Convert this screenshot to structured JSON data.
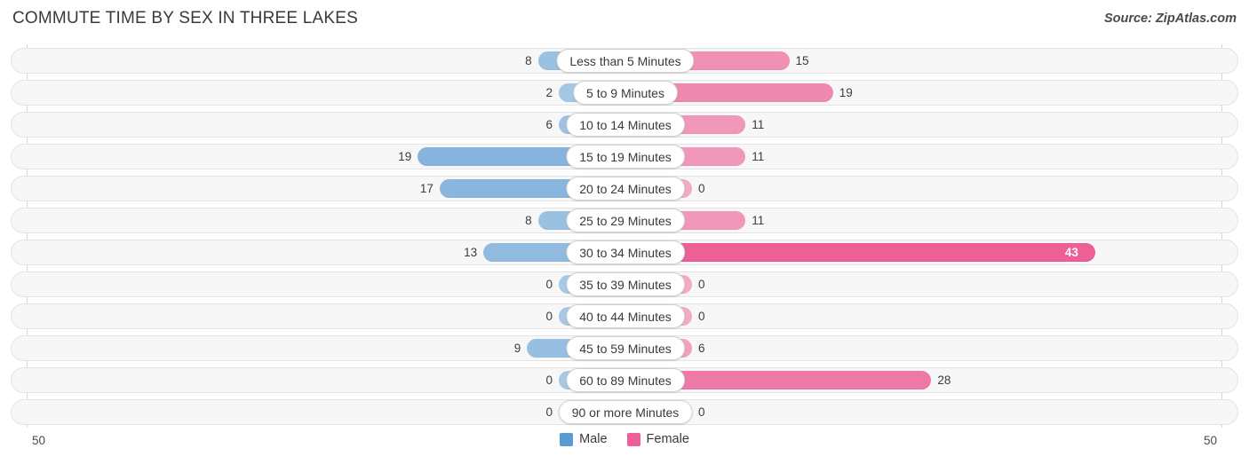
{
  "header": {
    "title": "COMMUTE TIME BY SEX IN THREE LAKES",
    "source": "Source: ZipAtlas.com"
  },
  "axis": {
    "left_max_label": "50",
    "right_max_label": "50"
  },
  "legend": {
    "items": [
      {
        "label": "Male",
        "color": "#5b9bd5"
      },
      {
        "label": "Female",
        "color": "#ee5f96"
      }
    ]
  },
  "chart_data": {
    "type": "bar",
    "subtype": "diverging-bar",
    "title": "COMMUTE TIME BY SEX IN THREE LAKES",
    "xlabel": "",
    "ylabel": "",
    "xlim": [
      -50,
      50
    ],
    "grid": false,
    "legend_position": "bottom-center",
    "axis_max": 50,
    "categories": [
      "Less than 5 Minutes",
      "5 to 9 Minutes",
      "10 to 14 Minutes",
      "15 to 19 Minutes",
      "20 to 24 Minutes",
      "25 to 29 Minutes",
      "30 to 34 Minutes",
      "35 to 39 Minutes",
      "40 to 44 Minutes",
      "45 to 59 Minutes",
      "60 to 89 Minutes",
      "90 or more Minutes"
    ],
    "series": [
      {
        "name": "Male",
        "color": "#5b9bd5",
        "side": "left",
        "values": [
          8,
          2,
          6,
          19,
          17,
          8,
          13,
          0,
          0,
          9,
          0,
          0
        ]
      },
      {
        "name": "Female",
        "color": "#ee5f96",
        "side": "right",
        "values": [
          15,
          19,
          11,
          11,
          0,
          11,
          43,
          0,
          0,
          6,
          28,
          0
        ]
      }
    ],
    "rows": [
      {
        "category": "Less than 5 Minutes",
        "male": 8,
        "female": 15,
        "male_label": "8",
        "female_label": "15"
      },
      {
        "category": "5 to 9 Minutes",
        "male": 2,
        "female": 19,
        "male_label": "2",
        "female_label": "19"
      },
      {
        "category": "10 to 14 Minutes",
        "male": 6,
        "female": 11,
        "male_label": "6",
        "female_label": "11"
      },
      {
        "category": "15 to 19 Minutes",
        "male": 19,
        "female": 11,
        "male_label": "19",
        "female_label": "11"
      },
      {
        "category": "20 to 24 Minutes",
        "male": 17,
        "female": 0,
        "male_label": "17",
        "female_label": "0"
      },
      {
        "category": "25 to 29 Minutes",
        "male": 8,
        "female": 11,
        "male_label": "8",
        "female_label": "11"
      },
      {
        "category": "30 to 34 Minutes",
        "male": 13,
        "female": 43,
        "male_label": "13",
        "female_label": "43"
      },
      {
        "category": "35 to 39 Minutes",
        "male": 0,
        "female": 0,
        "male_label": "0",
        "female_label": "0"
      },
      {
        "category": "40 to 44 Minutes",
        "male": 0,
        "female": 0,
        "male_label": "0",
        "female_label": "0"
      },
      {
        "category": "45 to 59 Minutes",
        "male": 9,
        "female": 6,
        "male_label": "9",
        "female_label": "6"
      },
      {
        "category": "60 to 89 Minutes",
        "male": 0,
        "female": 28,
        "male_label": "0",
        "female_label": "28"
      },
      {
        "category": "90 or more Minutes",
        "male": 0,
        "female": 0,
        "male_label": "0",
        "female_label": "0"
      }
    ]
  }
}
